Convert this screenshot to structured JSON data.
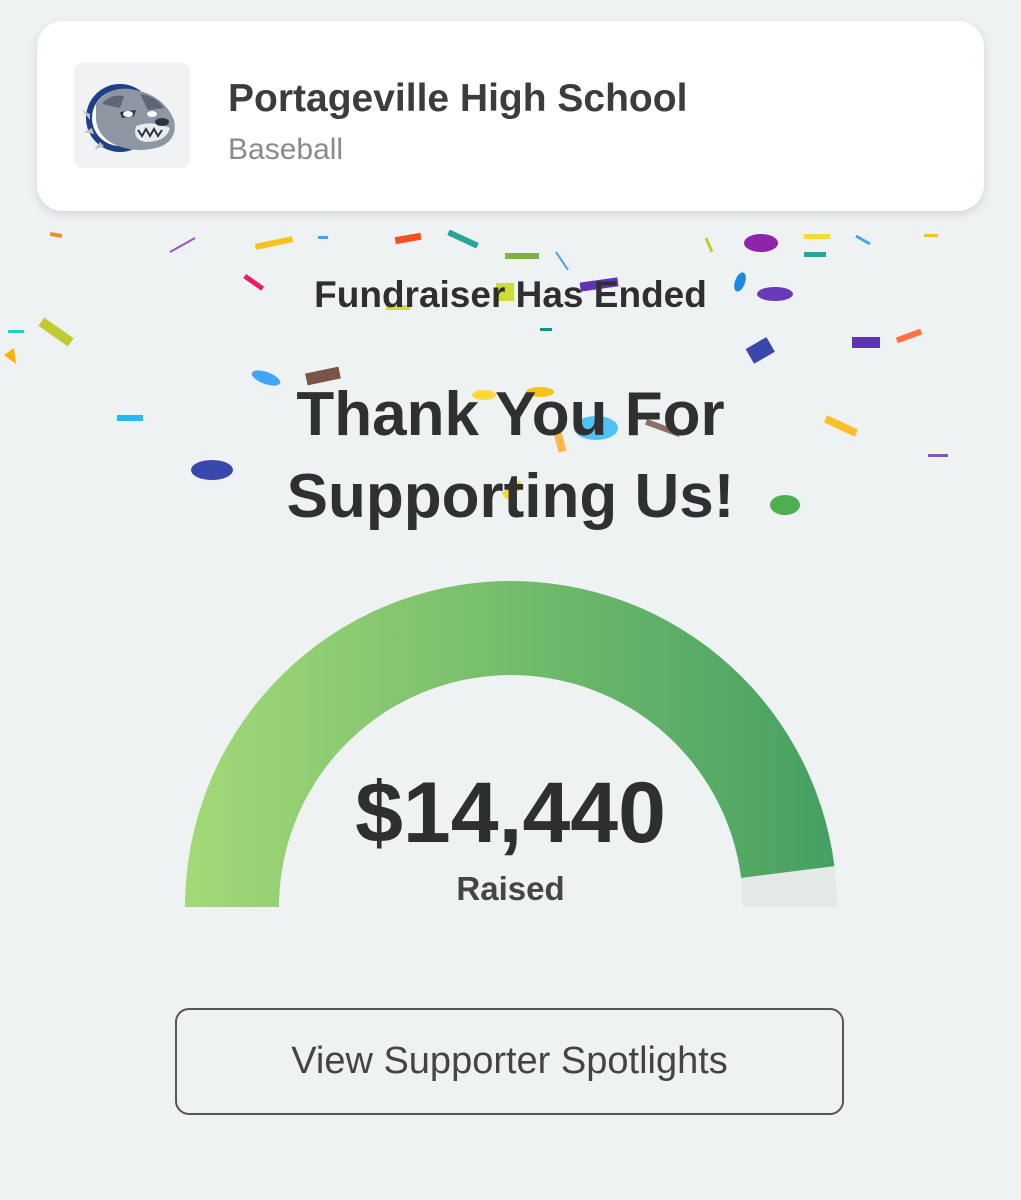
{
  "org": {
    "name": "Portageville High School",
    "subtitle": "Baseball",
    "logo_icon": "bulldog-mascot-icon"
  },
  "status": "Fundraiser Has Ended",
  "thank_you": {
    "line1": "Thank You For",
    "line2": "Supporting Us!"
  },
  "gauge": {
    "amount": "$14,440",
    "label": "Raised",
    "progress_fraction": 0.96,
    "gradient_start": "#a3d977",
    "gradient_end": "#45a062",
    "track_color": "#e4e8e8"
  },
  "actions": {
    "spotlight_label": "View Supporter Spotlights"
  }
}
